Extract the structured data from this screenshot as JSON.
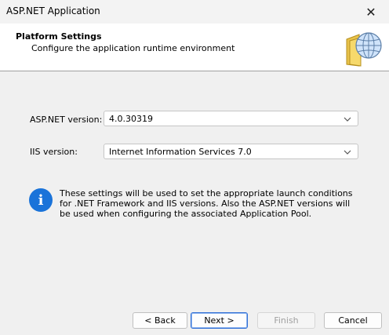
{
  "window": {
    "title": "ASP.NET Application",
    "close_glyph": "✕"
  },
  "header": {
    "title": "Platform Settings",
    "subtitle": "Configure the application runtime environment",
    "icon": "globe-document-icon"
  },
  "form": {
    "aspnet": {
      "label": "ASP.NET version:",
      "value": "4.0.30319"
    },
    "iis": {
      "label": "IIS version:",
      "value": "Internet Information Services 7.0"
    }
  },
  "info": {
    "icon": "info-icon",
    "glyph": "i",
    "text": "These settings will be used to set the appropriate launch conditions for .NET Framework and IIS versions. Also the ASP.NET versions will be used when configuring the associated Application Pool."
  },
  "buttons": {
    "back": "< Back",
    "next": "Next >",
    "finish": "Finish",
    "cancel": "Cancel"
  },
  "colors": {
    "accent": "#1a73d9",
    "primary_border": "#2f6fd6"
  }
}
